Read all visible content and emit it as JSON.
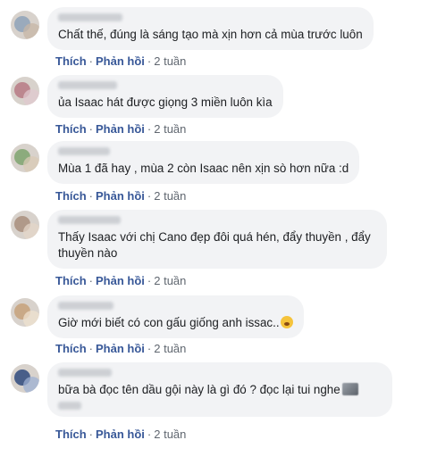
{
  "actions": {
    "like": "Thích",
    "reply": "Phản hồi",
    "separator": "·"
  },
  "comments": [
    {
      "text": "Chất thế, đúng là sáng tạo mà xịn hơn cả mùa trước luôn",
      "time": "2 tuần",
      "avatar_colors": [
        "#8fa3b8",
        "#c7b6a6"
      ]
    },
    {
      "text": "ủa Isaac hát được giọng 3 miền luôn kìa",
      "time": "2 tuần",
      "avatar_colors": [
        "#b77a84",
        "#e0c8cf"
      ]
    },
    {
      "text": "Mùa 1 đã hay , mùa 2 còn Isaac nên xịn sò hơn nữa :d",
      "time": "2 tuần",
      "avatar_colors": [
        "#7fa56f",
        "#d9c9b6"
      ]
    },
    {
      "text": "Thấy Isaac với chị Cano đẹp đôi quá hén, đẩy thuyền , đẩy thuyền nào",
      "time": "2 tuần",
      "avatar_colors": [
        "#a98f7c",
        "#e4d6c8"
      ]
    },
    {
      "text": "Giờ mới biết có con gấu giống anh issac..",
      "time": "2 tuần",
      "avatar_colors": [
        "#c7a27a",
        "#efe2cf"
      ]
    },
    {
      "text": "bữa bà đọc tên dầu gội này là gì đó ? đọc lại tui nghe",
      "time": "2 tuần",
      "avatar_colors": [
        "#2f4a7d",
        "#9db0d3"
      ]
    }
  ]
}
